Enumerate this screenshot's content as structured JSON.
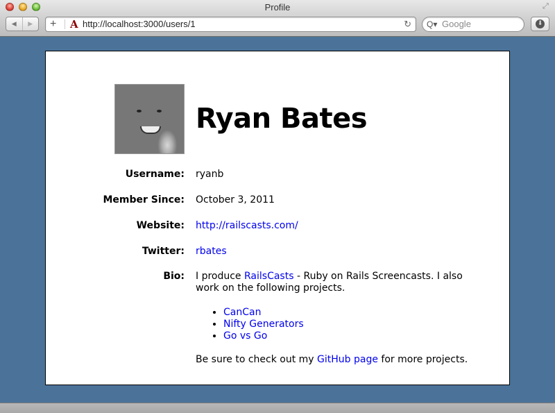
{
  "window": {
    "title": "Profile"
  },
  "toolbar": {
    "back_icon": "back-arrow-icon",
    "forward_icon": "forward-arrow-icon",
    "add_bookmark_label": "+",
    "url": "http://localhost:3000/users/1",
    "favicon_glyph": "A",
    "reload_glyph": "↻",
    "search_placeholder": "Google",
    "search_glyph": "Q▾"
  },
  "profile": {
    "name": "Ryan Bates",
    "fields": [
      {
        "label": "Username:",
        "value": "ryanb",
        "is_link": false
      },
      {
        "label": "Member Since:",
        "value": "October 3, 2011",
        "is_link": false
      },
      {
        "label": "Website:",
        "value": "http://railscasts.com/",
        "is_link": true
      },
      {
        "label": "Twitter:",
        "value": "rbates",
        "is_link": true
      }
    ],
    "bio": {
      "label": "Bio:",
      "intro_before": "I produce ",
      "intro_link": "RailsCasts",
      "intro_after": " - Ruby on Rails Screencasts. I also work on the following projects.",
      "projects": [
        "CanCan",
        "Nifty Generators",
        "Go vs Go"
      ],
      "outro_before": "Be sure to check out my ",
      "outro_link": "GitHub page",
      "outro_after": " for more projects."
    }
  },
  "colors": {
    "background": "#4b7399",
    "link": "#0000ee",
    "panel": "#ffffff"
  }
}
